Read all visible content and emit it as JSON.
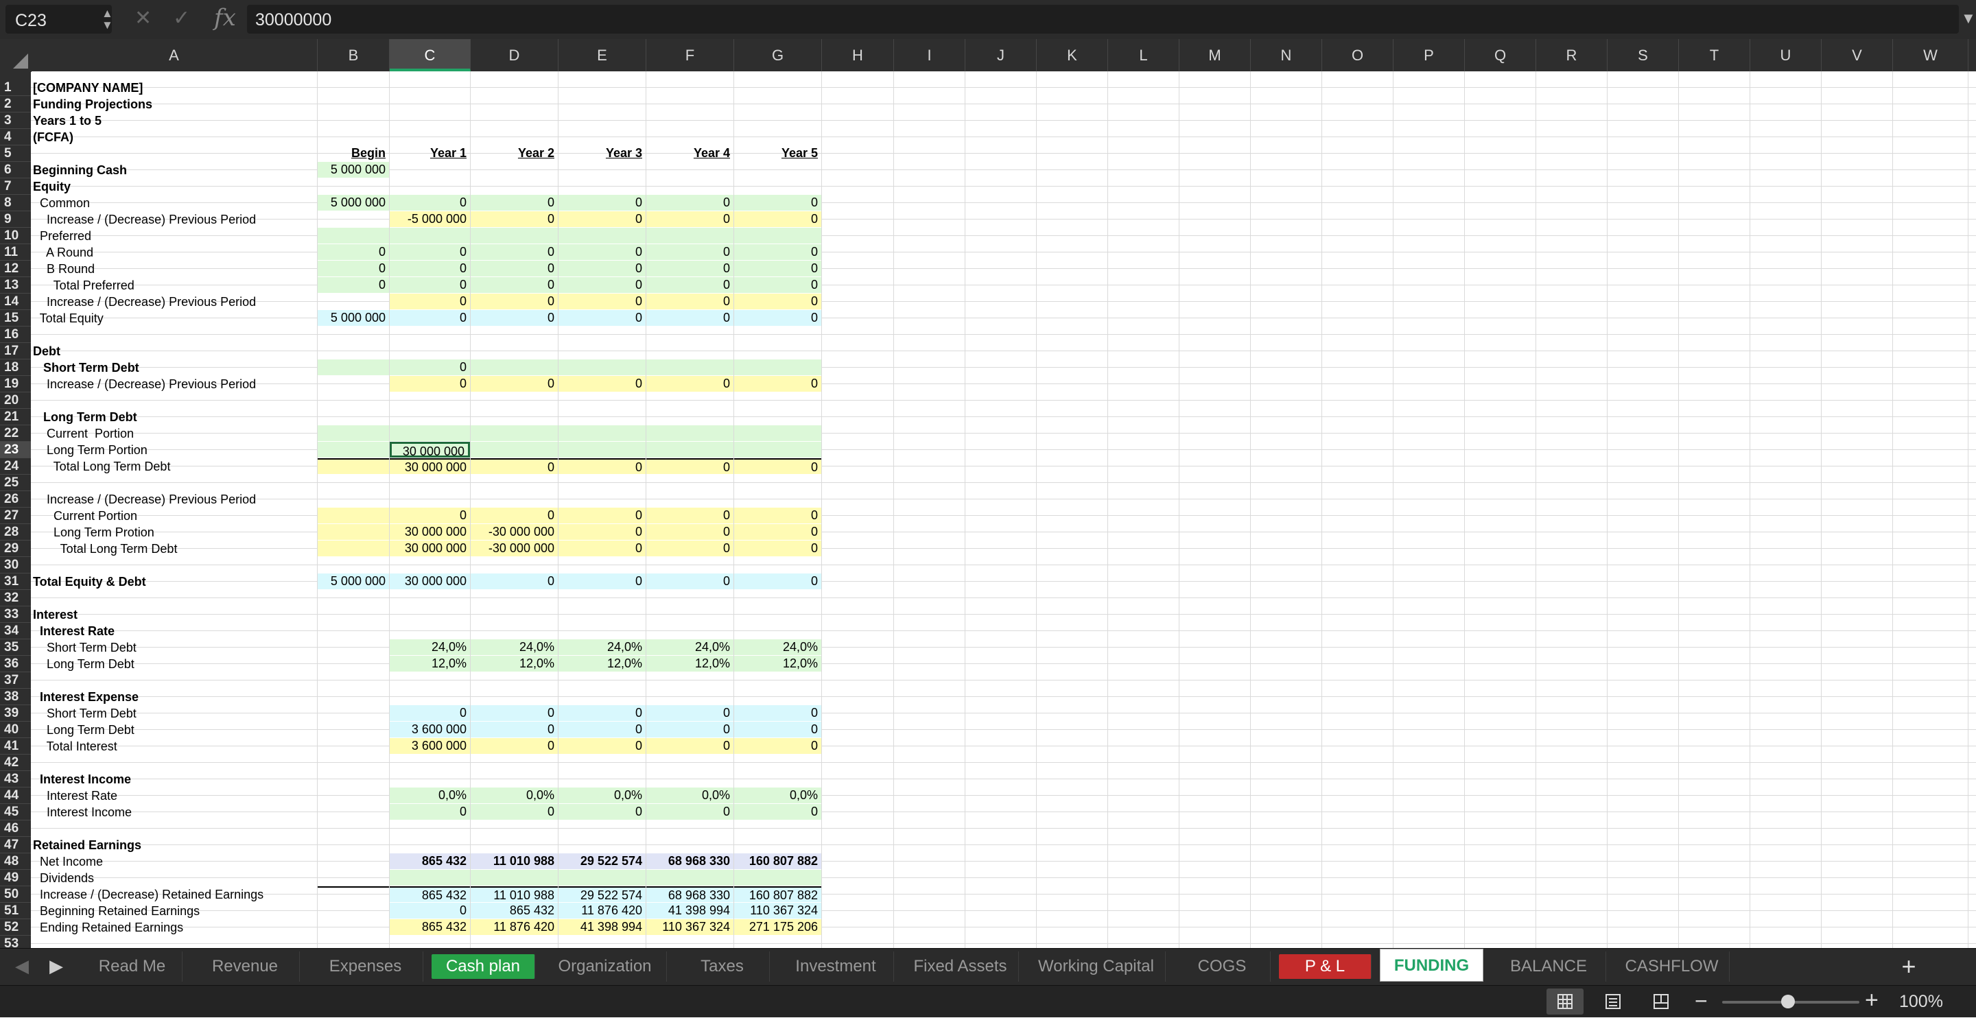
{
  "formula_bar": {
    "cell_ref": "C23",
    "cancel_symbol": "✕",
    "confirm_symbol": "✓",
    "fx_label": "fx",
    "formula": "30000000"
  },
  "columns": [
    "A",
    "B",
    "C",
    "D",
    "E",
    "F",
    "G",
    "H",
    "I",
    "J",
    "K",
    "L",
    "M",
    "N",
    "O",
    "P",
    "Q",
    "R",
    "S",
    "T",
    "U",
    "V",
    "W"
  ],
  "selected_column": "C",
  "selected_row": 23,
  "rows": [
    {
      "r": 1,
      "a": "[COMPANY NAME]",
      "ab": true
    },
    {
      "r": 2,
      "a": "Funding Projections",
      "ab": true
    },
    {
      "r": 3,
      "a": "Years 1 to 5",
      "ab": true
    },
    {
      "r": 4,
      "a": "(FCFA)",
      "ab": true
    },
    {
      "r": 5,
      "v": [
        "Begin",
        "Year 1",
        "Year 2",
        "Year 3",
        "Year 4",
        "Year 5"
      ],
      "hdr": true
    },
    {
      "r": 6,
      "a": "Beginning Cash",
      "ab": true,
      "v": [
        "5 000 000",
        "",
        "",
        "",
        "",
        ""
      ],
      "f": [
        "g",
        "",
        "",
        "",
        "",
        ""
      ]
    },
    {
      "r": 7,
      "a": "Equity",
      "ab": true
    },
    {
      "r": 8,
      "a": "  Common",
      "v": [
        "5 000 000",
        "0",
        "0",
        "0",
        "0",
        "0"
      ],
      "f": [
        "g",
        "g",
        "g",
        "g",
        "g",
        "g"
      ]
    },
    {
      "r": 9,
      "a": "    Increase / (Decrease) Previous Period",
      "v": [
        "",
        "-5 000 000",
        "0",
        "0",
        "0",
        "0"
      ],
      "f": [
        "",
        "y",
        "y",
        "y",
        "y",
        "y"
      ]
    },
    {
      "r": 10,
      "a": "  Preferred",
      "f": [
        "g",
        "g",
        "g",
        "g",
        "g",
        "g"
      ],
      "v": [
        "",
        "",
        "",
        "",
        "",
        ""
      ]
    },
    {
      "r": 11,
      "a": "    A Round",
      "v": [
        "0",
        "0",
        "0",
        "0",
        "0",
        "0"
      ],
      "f": [
        "g",
        "g",
        "g",
        "g",
        "g",
        "g"
      ]
    },
    {
      "r": 12,
      "a": "    B Round",
      "v": [
        "0",
        "0",
        "0",
        "0",
        "0",
        "0"
      ],
      "f": [
        "g",
        "g",
        "g",
        "g",
        "g",
        "g"
      ]
    },
    {
      "r": 13,
      "a": "      Total Preferred",
      "v": [
        "0",
        "0",
        "0",
        "0",
        "0",
        "0"
      ],
      "f": [
        "g",
        "g",
        "g",
        "g",
        "g",
        "g"
      ]
    },
    {
      "r": 14,
      "a": "    Increase / (Decrease) Previous Period",
      "v": [
        "",
        "0",
        "0",
        "0",
        "0",
        "0"
      ],
      "f": [
        "",
        "y",
        "y",
        "y",
        "y",
        "y"
      ]
    },
    {
      "r": 15,
      "a": "  Total Equity",
      "v": [
        "5 000 000",
        "0",
        "0",
        "0",
        "0",
        "0"
      ],
      "f": [
        "c",
        "c",
        "c",
        "c",
        "c",
        "c"
      ]
    },
    {
      "r": 16
    },
    {
      "r": 17,
      "a": "Debt",
      "ab": true
    },
    {
      "r": 18,
      "a": "   Short Term Debt",
      "ab": true,
      "v": [
        "",
        "0",
        "",
        "",
        "",
        ""
      ],
      "f": [
        "g",
        "g",
        "g",
        "g",
        "g",
        "g"
      ]
    },
    {
      "r": 19,
      "a": "    Increase / (Decrease) Previous Period",
      "v": [
        "",
        "0",
        "0",
        "0",
        "0",
        "0"
      ],
      "f": [
        "",
        "y",
        "y",
        "y",
        "y",
        "y"
      ]
    },
    {
      "r": 20
    },
    {
      "r": 21,
      "a": "   Long Term Debt",
      "ab": true
    },
    {
      "r": 22,
      "a": "    Current  Portion",
      "v": [
        "",
        "",
        "",
        "",
        "",
        ""
      ],
      "f": [
        "g",
        "g",
        "g",
        "g",
        "g",
        "g"
      ]
    },
    {
      "r": 23,
      "a": "    Long Term Portion",
      "v": [
        "",
        "30 000 000",
        "",
        "",
        "",
        ""
      ],
      "f": [
        "g",
        "g",
        "g",
        "g",
        "g",
        "g"
      ]
    },
    {
      "r": 24,
      "a": "      Total Long Term Debt",
      "v": [
        "",
        "30 000 000",
        "0",
        "0",
        "0",
        "0"
      ],
      "f": [
        "y",
        "y",
        "y",
        "y",
        "y",
        "y"
      ],
      "topline": true
    },
    {
      "r": 25
    },
    {
      "r": 26,
      "a": "    Increase / (Decrease) Previous Period"
    },
    {
      "r": 27,
      "a": "      Current Portion",
      "v": [
        "",
        "0",
        "0",
        "0",
        "0",
        "0"
      ],
      "f": [
        "y",
        "y",
        "y",
        "y",
        "y",
        "y"
      ]
    },
    {
      "r": 28,
      "a": "      Long Term Protion",
      "v": [
        "",
        "30 000 000",
        "-30 000 000",
        "0",
        "0",
        "0"
      ],
      "f": [
        "y",
        "y",
        "y",
        "y",
        "y",
        "y"
      ]
    },
    {
      "r": 29,
      "a": "        Total Long Term Debt",
      "v": [
        "",
        "30 000 000",
        "-30 000 000",
        "0",
        "0",
        "0"
      ],
      "f": [
        "y",
        "y",
        "y",
        "y",
        "y",
        "y"
      ]
    },
    {
      "r": 30
    },
    {
      "r": 31,
      "a": "Total Equity & Debt",
      "ab": true,
      "v": [
        "5 000 000",
        "30 000 000",
        "0",
        "0",
        "0",
        "0"
      ],
      "f": [
        "c",
        "c",
        "c",
        "c",
        "c",
        "c"
      ]
    },
    {
      "r": 32
    },
    {
      "r": 33,
      "a": "Interest",
      "ab": true
    },
    {
      "r": 34,
      "a": "  Interest Rate",
      "ab": true
    },
    {
      "r": 35,
      "a": "    Short Term Debt",
      "v": [
        "",
        "24,0%",
        "24,0%",
        "24,0%",
        "24,0%",
        "24,0%"
      ],
      "f": [
        "",
        "g",
        "g",
        "g",
        "g",
        "g"
      ]
    },
    {
      "r": 36,
      "a": "    Long Term Debt",
      "v": [
        "",
        "12,0%",
        "12,0%",
        "12,0%",
        "12,0%",
        "12,0%"
      ],
      "f": [
        "",
        "g",
        "g",
        "g",
        "g",
        "g"
      ]
    },
    {
      "r": 37
    },
    {
      "r": 38,
      "a": "  Interest Expense",
      "ab": true
    },
    {
      "r": 39,
      "a": "    Short Term Debt",
      "v": [
        "",
        "0",
        "0",
        "0",
        "0",
        "0"
      ],
      "f": [
        "",
        "c",
        "c",
        "c",
        "c",
        "c"
      ]
    },
    {
      "r": 40,
      "a": "    Long Term Debt",
      "v": [
        "",
        "3 600 000",
        "0",
        "0",
        "0",
        "0"
      ],
      "f": [
        "",
        "c",
        "c",
        "c",
        "c",
        "c"
      ]
    },
    {
      "r": 41,
      "a": "    Total Interest",
      "v": [
        "",
        "3 600 000",
        "0",
        "0",
        "0",
        "0"
      ],
      "f": [
        "",
        "y",
        "y",
        "y",
        "y",
        "y"
      ]
    },
    {
      "r": 42
    },
    {
      "r": 43,
      "a": "  Interest Income",
      "ab": true
    },
    {
      "r": 44,
      "a": "    Interest Rate",
      "v": [
        "",
        "0,0%",
        "0,0%",
        "0,0%",
        "0,0%",
        "0,0%"
      ],
      "f": [
        "",
        "g",
        "g",
        "g",
        "g",
        "g"
      ]
    },
    {
      "r": 45,
      "a": "    Interest Income",
      "v": [
        "",
        "0",
        "0",
        "0",
        "0",
        "0"
      ],
      "f": [
        "",
        "g",
        "g",
        "g",
        "g",
        "g"
      ]
    },
    {
      "r": 46
    },
    {
      "r": 47,
      "a": "Retained Earnings",
      "ab": true
    },
    {
      "r": 48,
      "a": "  Net Income",
      "v": [
        "",
        "865 432",
        "11 010 988",
        "29 522 574",
        "68 968 330",
        "160 807 882"
      ],
      "f": [
        "",
        "b",
        "b",
        "b",
        "b",
        "b"
      ],
      "vb": true
    },
    {
      "r": 49,
      "a": "  Dividends",
      "v": [
        "",
        "",
        "",
        "",
        "",
        ""
      ],
      "f": [
        "",
        "g",
        "g",
        "g",
        "g",
        "g"
      ]
    },
    {
      "r": 50,
      "a": "  Increase / (Decrease) Retained Earnings",
      "v": [
        "",
        "865 432",
        "11 010 988",
        "29 522 574",
        "68 968 330",
        "160 807 882"
      ],
      "f": [
        "",
        "c",
        "c",
        "c",
        "c",
        "c"
      ],
      "topline": true
    },
    {
      "r": 51,
      "a": "  Beginning Retained Earnings",
      "v": [
        "",
        "0",
        "865 432",
        "11 876 420",
        "41 398 994",
        "110 367 324"
      ],
      "f": [
        "",
        "c",
        "c",
        "c",
        "c",
        "c"
      ]
    },
    {
      "r": 52,
      "a": "  Ending Retained Earnings",
      "v": [
        "",
        "865 432",
        "11 876 420",
        "41 398 994",
        "110 367 324",
        "271 175 206"
      ],
      "f": [
        "",
        "y",
        "y",
        "y",
        "y",
        "y"
      ]
    },
    {
      "r": 53
    }
  ],
  "sheet_tabs": [
    "Read Me",
    "Revenue",
    "Expenses",
    "Cash plan",
    "Organization",
    "Taxes",
    "Investment",
    "Fixed Assets",
    "Working Capital",
    "COGS",
    "P & L",
    "FUNDING",
    "BALANCE",
    "CASHFLOW"
  ],
  "active_tab": "FUNDING",
  "tab_colors": {
    "Cash plan": "#27a348",
    "P & L": "#c42b2b"
  },
  "tab_controls": {
    "prev": "◀",
    "next": "▶",
    "add": "+"
  },
  "status": {
    "zoom": "100%",
    "zoom_minus": "−",
    "zoom_plus": "+"
  }
}
